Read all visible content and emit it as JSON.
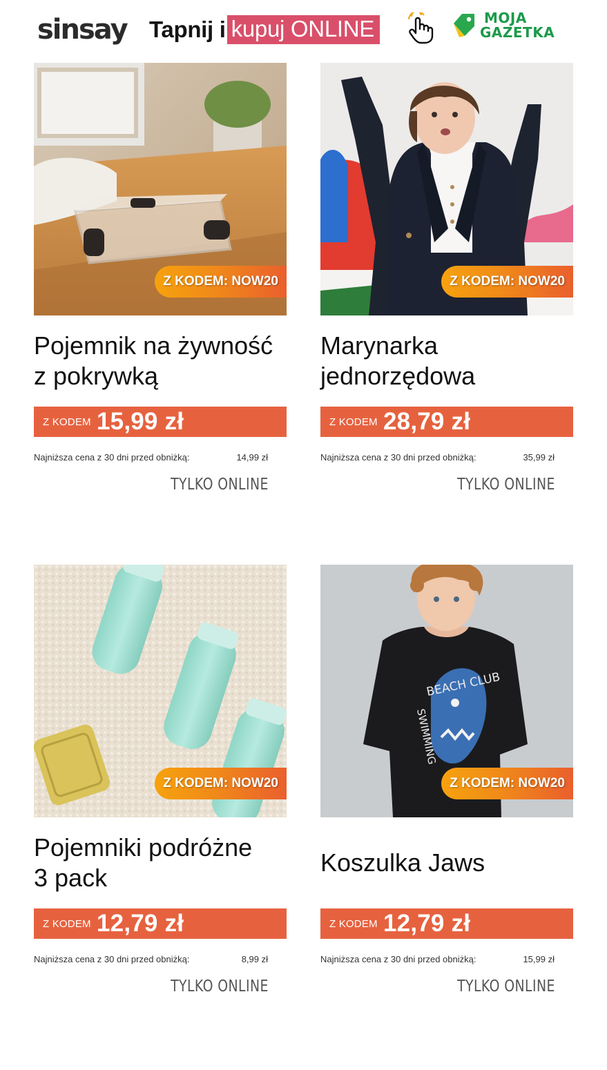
{
  "header": {
    "logo_text": "sinsay",
    "tagline_plain": "Tapnij i",
    "tagline_highlight": "kupuj ONLINE",
    "hand_icon": "pointer-hand-icon",
    "gazetka_line1": "MOJA",
    "gazetka_line2": "GAZETKA",
    "brand_pink": "#d94f6a",
    "brand_green": "#1d9a4a"
  },
  "products": [
    {
      "title_line1": "Pojemnik na żywność",
      "title_line2": "z pokrywką",
      "badge": "Z KODEM: NOW20",
      "price_label": "Z KODEM",
      "price": "15,99 zł",
      "lowest_label": "Najniższa cena z 30 dni przed obniżką:",
      "lowest_value": "14,99 zł",
      "online": "TYLKO ONLINE"
    },
    {
      "title_line1": "Marynarka",
      "title_line2": "jednorzędowa",
      "badge": "Z KODEM: NOW20",
      "price_label": "Z KODEM",
      "price": "28,79 zł",
      "lowest_label": "Najniższa cena z 30 dni przed obniżką:",
      "lowest_value": "35,99 zł",
      "online": "TYLKO ONLINE"
    },
    {
      "title_line1": "Pojemniki podróżne",
      "title_line2": "3 pack",
      "badge": "Z KODEM: NOW20",
      "price_label": "Z KODEM",
      "price": "12,79 zł",
      "lowest_label": "Najniższa cena z 30 dni przed obniżką:",
      "lowest_value": "8,99 zł",
      "online": "TYLKO ONLINE"
    },
    {
      "title_line1": "Koszulka Jaws",
      "title_line2": "",
      "badge": "Z KODEM: NOW20",
      "price_label": "Z KODEM",
      "price": "12,79 zł",
      "lowest_label": "Najniższa cena z 30 dni przed obniżką:",
      "lowest_value": "15,99 zł",
      "online": "TYLKO ONLINE",
      "shirt_print_1": "BEACH CLUB",
      "shirt_print_2": "SWIMMING"
    }
  ],
  "colors": {
    "price_bar": "#e6623f",
    "badge_start": "#f6a20e",
    "badge_end": "#ea5f2d"
  }
}
